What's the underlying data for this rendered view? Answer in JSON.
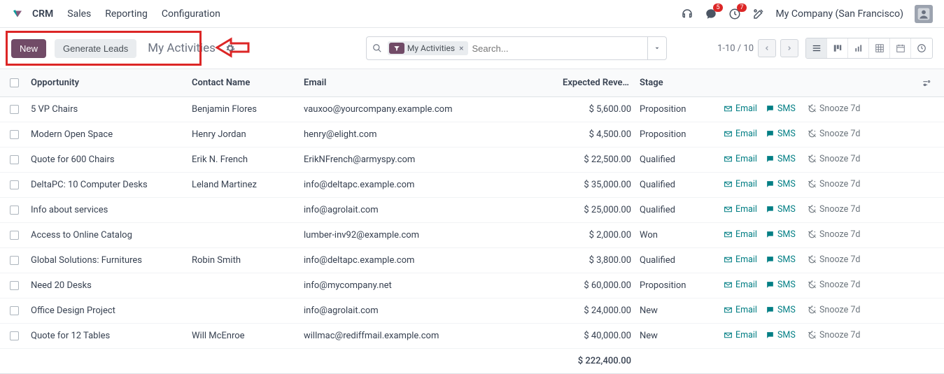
{
  "nav": {
    "items": [
      "CRM",
      "Sales",
      "Reporting",
      "Configuration"
    ],
    "messages_badge": "5",
    "activities_badge": "7",
    "company": "My Company (San Francisco)"
  },
  "controls": {
    "new_label": "New",
    "generate_label": "Generate Leads",
    "breadcrumb": "My Activities",
    "filter_chip": "My Activities",
    "search_placeholder": "Search...",
    "pager": "1-10 / 10"
  },
  "columns": {
    "opportunity": "Opportunity",
    "contact": "Contact Name",
    "email": "Email",
    "revenue": "Expected Revenue",
    "stage": "Stage"
  },
  "actions": {
    "email": "Email",
    "sms": "SMS",
    "snooze": "Snooze 7d"
  },
  "rows": [
    {
      "opp": "5 VP Chairs",
      "contact": "Benjamin Flores",
      "email": "vauxoo@yourcompany.example.com",
      "rev": "$ 5,600.00",
      "stage": "Proposition"
    },
    {
      "opp": "Modern Open Space",
      "contact": "Henry Jordan",
      "email": "henry@elight.com",
      "rev": "$ 4,500.00",
      "stage": "Proposition"
    },
    {
      "opp": "Quote for 600 Chairs",
      "contact": "Erik N. French",
      "email": "ErikNFrench@armyspy.com",
      "rev": "$ 22,500.00",
      "stage": "Qualified"
    },
    {
      "opp": "DeltaPC: 10 Computer Desks",
      "contact": "Leland Martinez",
      "email": "info@deltapc.example.com",
      "rev": "$ 35,000.00",
      "stage": "Qualified"
    },
    {
      "opp": "Info about services",
      "contact": "",
      "email": "info@agrolait.com",
      "rev": "$ 25,000.00",
      "stage": "Qualified"
    },
    {
      "opp": "Access to Online Catalog",
      "contact": "",
      "email": "lumber-inv92@example.com",
      "rev": "$ 2,000.00",
      "stage": "Won"
    },
    {
      "opp": "Global Solutions: Furnitures",
      "contact": "Robin Smith",
      "email": "info@deltapc.example.com",
      "rev": "$ 3,800.00",
      "stage": "Qualified"
    },
    {
      "opp": "Need 20 Desks",
      "contact": "",
      "email": "info@mycompany.net",
      "rev": "$ 60,000.00",
      "stage": "Proposition"
    },
    {
      "opp": "Office Design Project",
      "contact": "",
      "email": "info@agrolait.com",
      "rev": "$ 24,000.00",
      "stage": "New"
    },
    {
      "opp": "Quote for 12 Tables",
      "contact": "Will McEnroe",
      "email": "willmac@rediffmail.example.com",
      "rev": "$ 40,000.00",
      "stage": "New"
    }
  ],
  "total_revenue": "$ 222,400.00"
}
